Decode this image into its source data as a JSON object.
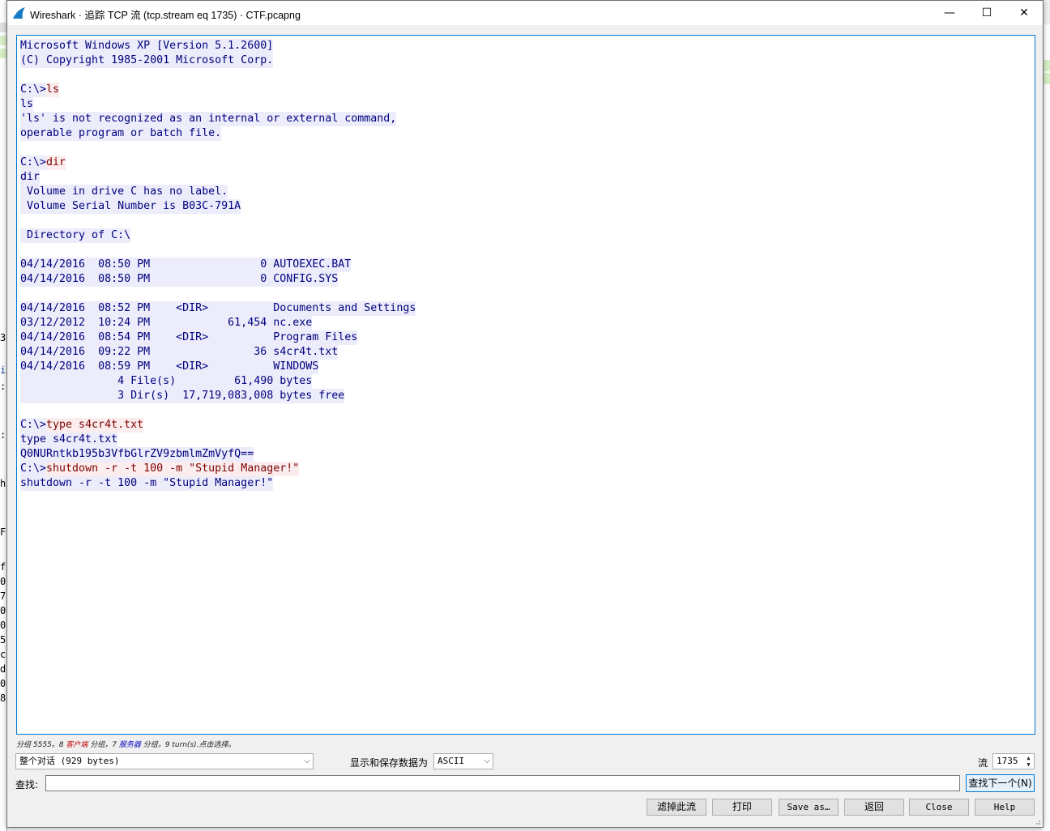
{
  "window": {
    "title": "Wireshark · 追踪 TCP 流 (tcp.stream eq 1735) · CTF.pcapng",
    "minimize_glyph": "—",
    "maximize_glyph": "☐",
    "close_glyph": "✕"
  },
  "stream": {
    "lines": [
      {
        "who": "srv",
        "text": "Microsoft Windows XP [Version 5.1.2600]"
      },
      {
        "who": "srv",
        "text": "(C) Copyright 1985-2001 Microsoft Corp."
      },
      {
        "who": "srv",
        "text": ""
      },
      {
        "who": "mix",
        "prompt": "C:\\>",
        "cmd": "ls"
      },
      {
        "who": "srv",
        "text": "ls"
      },
      {
        "who": "srv",
        "text": "'ls' is not recognized as an internal or external command,"
      },
      {
        "who": "srv",
        "text": "operable program or batch file."
      },
      {
        "who": "srv",
        "text": ""
      },
      {
        "who": "mix",
        "prompt": "C:\\>",
        "cmd": "dir"
      },
      {
        "who": "srv",
        "text": "dir"
      },
      {
        "who": "srv",
        "text": " Volume in drive C has no label."
      },
      {
        "who": "srv",
        "text": " Volume Serial Number is B03C-791A"
      },
      {
        "who": "srv",
        "text": ""
      },
      {
        "who": "srv",
        "text": " Directory of C:\\"
      },
      {
        "who": "srv",
        "text": ""
      },
      {
        "who": "srv",
        "text": "04/14/2016  08:50 PM                 0 AUTOEXEC.BAT"
      },
      {
        "who": "srv",
        "text": "04/14/2016  08:50 PM                 0 CONFIG.SYS"
      },
      {
        "who": "srv",
        "text": ""
      },
      {
        "who": "srv",
        "text": "04/14/2016  08:52 PM    <DIR>          Documents and Settings"
      },
      {
        "who": "srv",
        "text": "03/12/2012  10:24 PM            61,454 nc.exe"
      },
      {
        "who": "srv",
        "text": "04/14/2016  08:54 PM    <DIR>          Program Files"
      },
      {
        "who": "srv",
        "text": "04/14/2016  09:22 PM                36 s4cr4t.txt"
      },
      {
        "who": "srv",
        "text": "04/14/2016  08:59 PM    <DIR>          WINDOWS"
      },
      {
        "who": "srv",
        "text": "               4 File(s)         61,490 bytes"
      },
      {
        "who": "srv",
        "text": "               3 Dir(s)  17,719,083,008 bytes free"
      },
      {
        "who": "srv",
        "text": ""
      },
      {
        "who": "mix",
        "prompt": "C:\\>",
        "cmd": "type s4cr4t.txt"
      },
      {
        "who": "srv",
        "text": "type s4cr4t.txt"
      },
      {
        "who": "srv",
        "text": "Q0NURntkb195b3VfbGlrZV9zbmlmZmVyfQ=="
      },
      {
        "who": "mix",
        "prompt": "C:\\>",
        "cmd": "shutdown -r -t 100 -m \"Stupid Manager!\""
      },
      {
        "who": "srv",
        "text": "shutdown -r -t 100 -m \"Stupid Manager!\""
      }
    ]
  },
  "summary": {
    "prefix": "分组 5555。8 ",
    "client_word": "客户端",
    "mid": " 分组，7 ",
    "server_word": "服务器",
    "suffix": " 分组，9 turn(s).点击选择。"
  },
  "controls": {
    "conversation_value": "整个对话 (929 bytes)",
    "show_as_label": "显示和保存数据为",
    "encoding_value": "ASCII",
    "stream_label": "流",
    "stream_value": "1735",
    "find_label": "查找:",
    "find_value": "",
    "find_next_label": "查找下一个(N)"
  },
  "buttons": {
    "filter_out": "滤掉此流",
    "print": "打印",
    "save_as": "Save as…",
    "back": "返回",
    "close": "Close",
    "help": "Help"
  },
  "background_peek": {
    "marks": [
      "3",
      "i",
      ":",
      ":",
      "h",
      "F",
      "f",
      "0",
      "7",
      "0",
      "0",
      "5",
      "c",
      "d",
      "0",
      "8"
    ]
  },
  "colors": {
    "server_bg": "#ececfb",
    "server_fg": "#00007f",
    "client_bg": "#fbeded",
    "client_fg": "#7f0000",
    "focus_border": "#0078d7"
  }
}
